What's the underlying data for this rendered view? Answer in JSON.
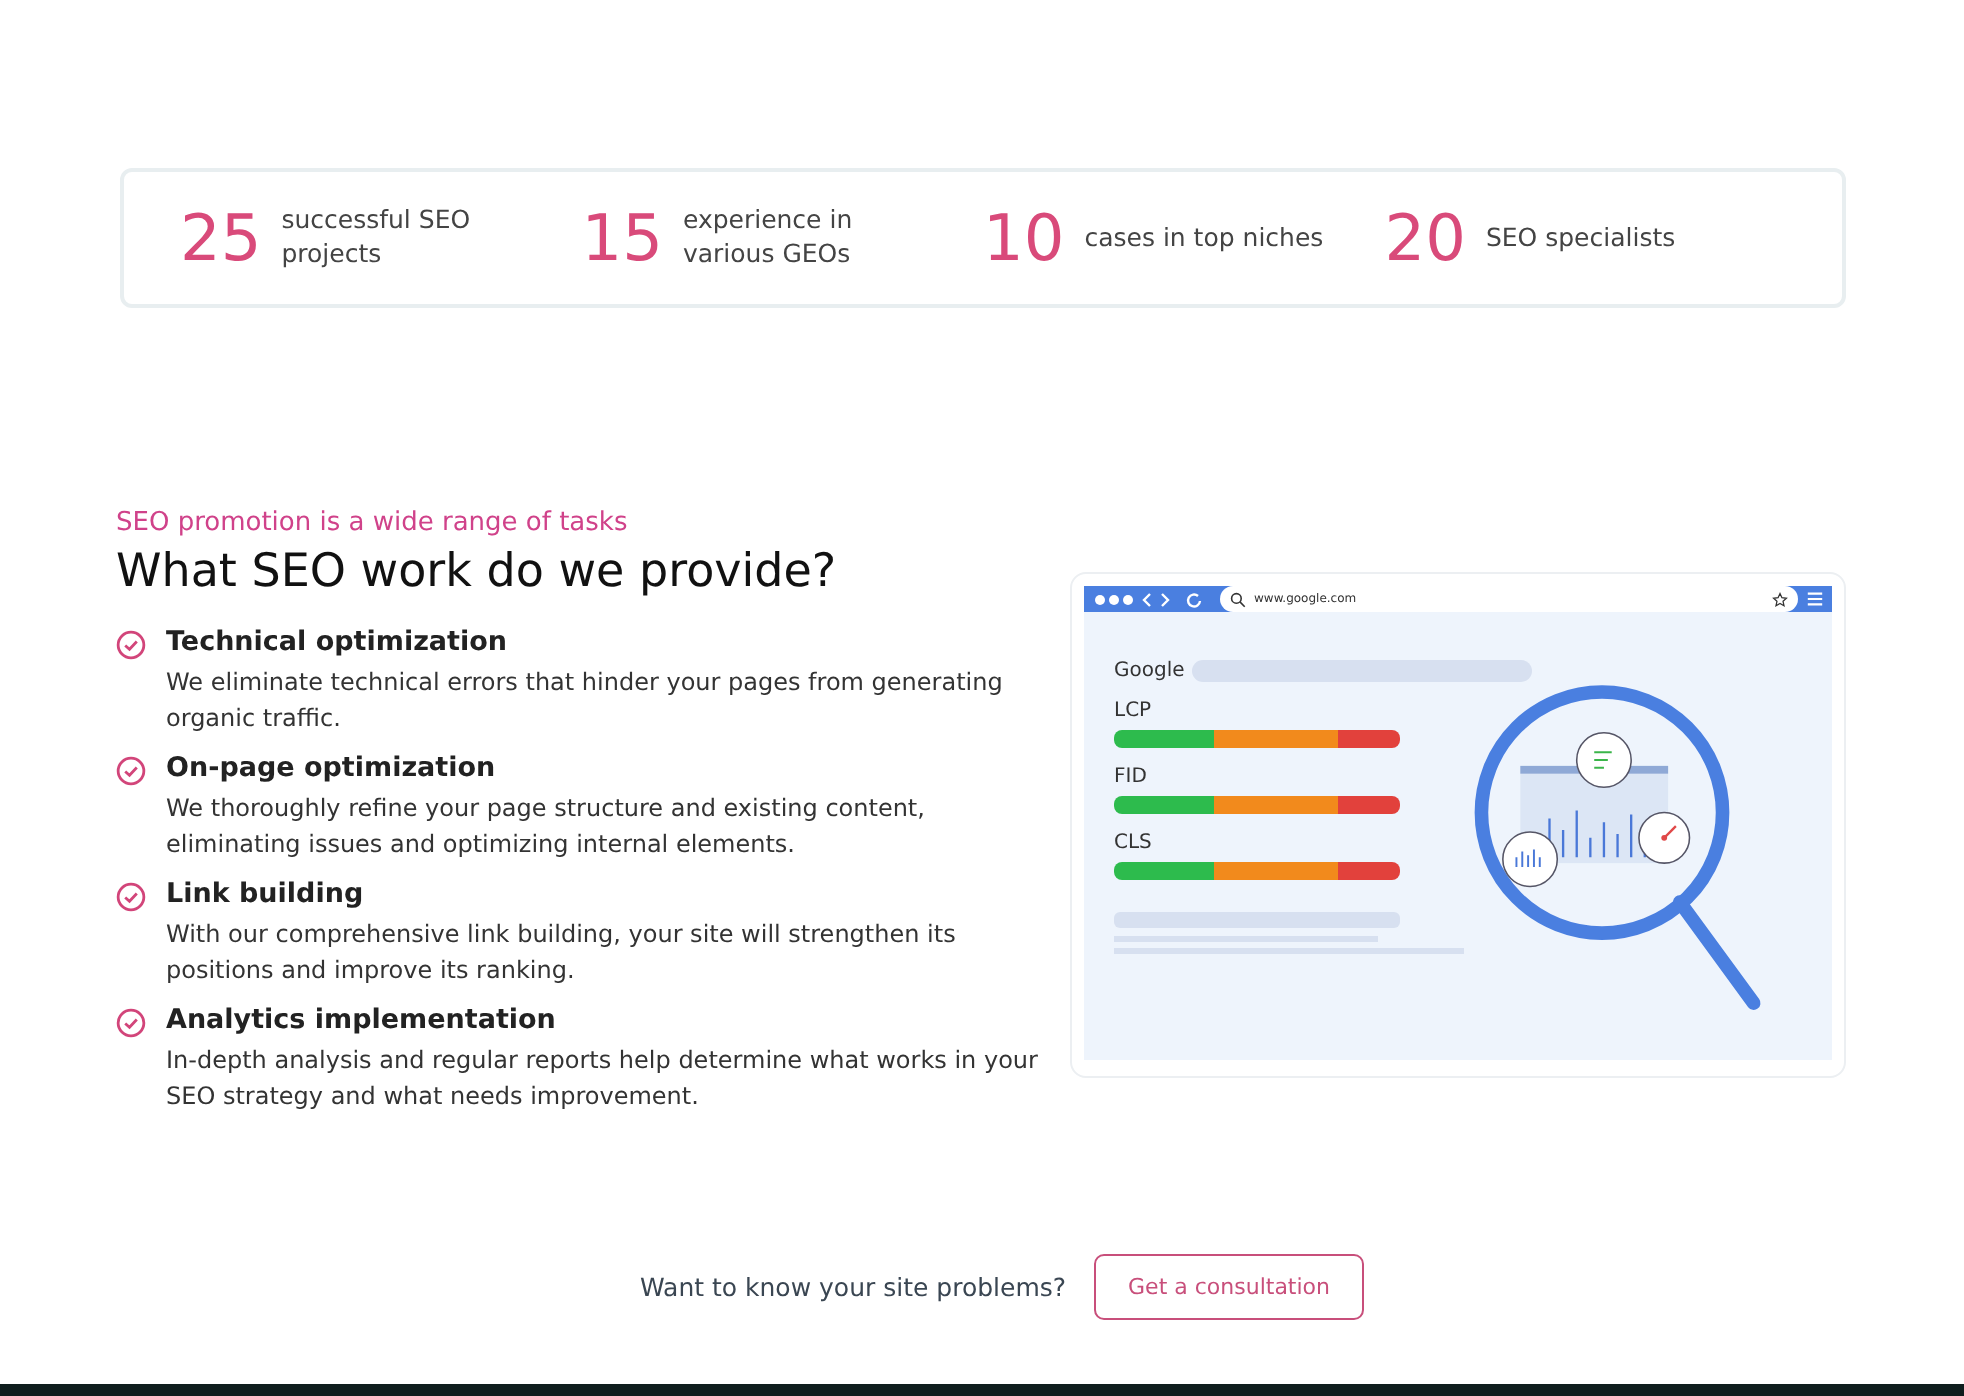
{
  "stats": [
    {
      "number": "25",
      "label": "successful SEO projects"
    },
    {
      "number": "15",
      "label": "experience in various GEOs"
    },
    {
      "number": "10",
      "label": "cases in top niches"
    },
    {
      "number": "20",
      "label": "SEO specialists"
    }
  ],
  "section": {
    "eyebrow": "SEO promotion is a wide range of tasks",
    "title": "What SEO work do we provide?",
    "services": [
      {
        "title": "Technical optimization",
        "text": "We eliminate technical errors that hinder your pages from generating organic traffic."
      },
      {
        "title": "On-page optimization",
        "text": "We thoroughly refine your page structure and existing content, eliminating issues and optimizing internal elements."
      },
      {
        "title": "Link building",
        "text": "With our comprehensive link building, your site will strengthen its positions and improve its ranking."
      },
      {
        "title": "Analytics implementation",
        "text": "In-depth analysis and regular reports help determine what works in your SEO strategy and what needs improvement."
      }
    ]
  },
  "illustration": {
    "url": "www.google.com",
    "brand": "Google",
    "metrics": [
      "LCP",
      "FID",
      "CLS"
    ]
  },
  "cta": {
    "question": "Want to know your site problems?",
    "button": "Get a consultation"
  }
}
